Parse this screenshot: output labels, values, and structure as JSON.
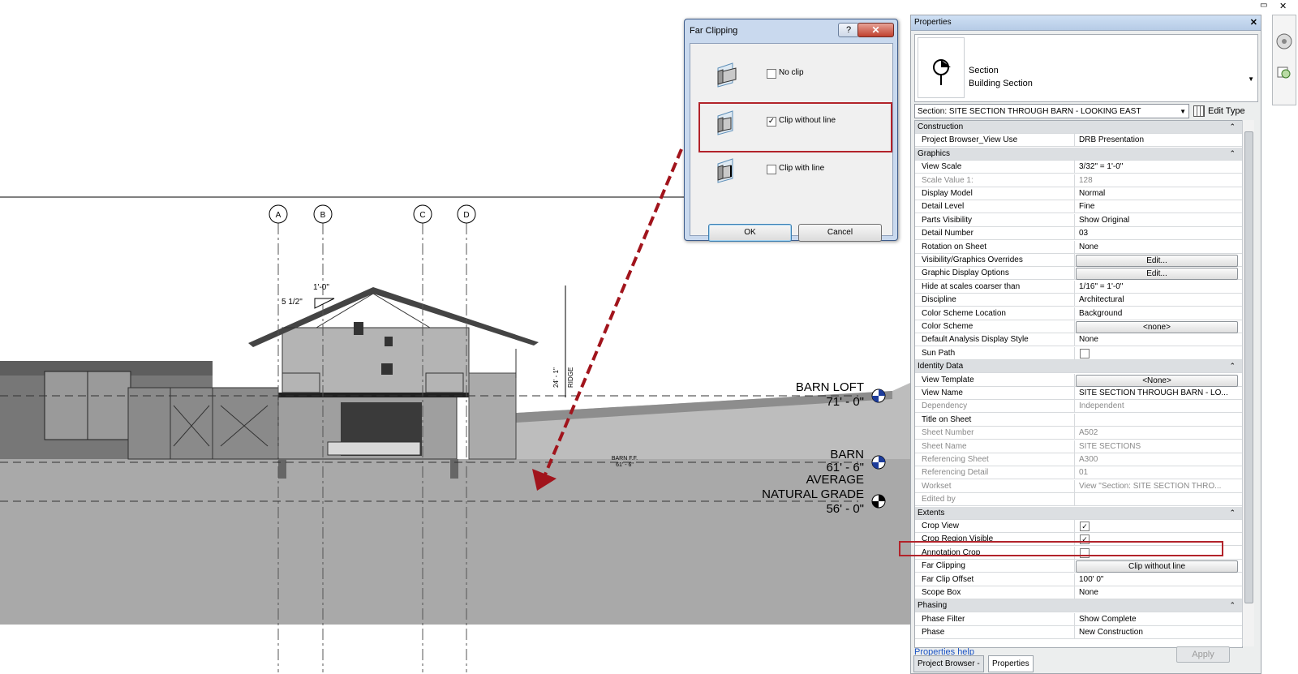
{
  "drawing": {
    "grids": [
      "A",
      "B",
      "C",
      "D"
    ],
    "dim_rise": "1'-0\"",
    "dim_pitch": "5 1/2\"",
    "dim_height": "24' - 1\"",
    "dim_label": "RIDGE",
    "level_barn_loft": "BARN LOFT",
    "level_barn_loft_elev": "71' - 0\"",
    "level_barn": "BARN",
    "level_barn_elev": "61' - 6\"",
    "level_grade_1": "AVERAGE",
    "level_grade_2": "NATURAL GRADE",
    "level_grade_elev": "56' - 0\"",
    "floor_label": "BARN F.F.",
    "floor_elev": "61' - 6\""
  },
  "dialog": {
    "title": "Far Clipping",
    "help": "?",
    "close": "✕",
    "options": [
      {
        "label": "No clip",
        "checked": false
      },
      {
        "label": "Clip without line",
        "checked": true
      },
      {
        "label": "Clip with line",
        "checked": false
      }
    ],
    "ok": "OK",
    "cancel": "Cancel"
  },
  "properties": {
    "title": "Properties",
    "close": "✕",
    "type_name": "Section",
    "type_subname": "Building Section",
    "instance_selector": "Section: SITE SECTION THROUGH BARN - LOOKING EAST",
    "edit_type": "Edit Type",
    "rows": [
      {
        "kind": "group",
        "k": "Construction"
      },
      {
        "k": "Project Browser_View Use",
        "v": "DRB Presentation"
      },
      {
        "kind": "group",
        "k": "Graphics"
      },
      {
        "k": "View Scale",
        "v": "3/32\" = 1'-0\""
      },
      {
        "k": "Scale Value    1:",
        "v": "128",
        "dis": true
      },
      {
        "k": "Display Model",
        "v": "Normal"
      },
      {
        "k": "Detail Level",
        "v": "Fine"
      },
      {
        "k": "Parts Visibility",
        "v": "Show Original"
      },
      {
        "k": "Detail Number",
        "v": "03"
      },
      {
        "k": "Rotation on Sheet",
        "v": "None"
      },
      {
        "k": "Visibility/Graphics Overrides",
        "btn": "Edit..."
      },
      {
        "k": "Graphic Display Options",
        "btn": "Edit..."
      },
      {
        "k": "Hide at scales coarser than",
        "v": "1/16\" = 1'-0\""
      },
      {
        "k": "Discipline",
        "v": "Architectural"
      },
      {
        "k": "Color Scheme Location",
        "v": "Background"
      },
      {
        "k": "Color Scheme",
        "btn": "<none>"
      },
      {
        "k": "Default Analysis Display Style",
        "v": "None"
      },
      {
        "k": "Sun Path",
        "chk": false
      },
      {
        "kind": "group",
        "k": "Identity Data"
      },
      {
        "k": "View Template",
        "btn": "<None>"
      },
      {
        "k": "View Name",
        "v": "SITE SECTION THROUGH BARN - LO..."
      },
      {
        "k": "Dependency",
        "v": "Independent",
        "dis": true
      },
      {
        "k": "Title on Sheet",
        "v": ""
      },
      {
        "k": "Sheet Number",
        "v": "A502",
        "dis": true
      },
      {
        "k": "Sheet Name",
        "v": "SITE SECTIONS",
        "dis": true
      },
      {
        "k": "Referencing Sheet",
        "v": "A300",
        "dis": true
      },
      {
        "k": "Referencing Detail",
        "v": "01",
        "dis": true
      },
      {
        "k": "Workset",
        "v": "View \"Section: SITE SECTION THRO...",
        "dis": true
      },
      {
        "k": "Edited by",
        "v": "",
        "dis": true
      },
      {
        "kind": "group",
        "k": "Extents"
      },
      {
        "k": "Crop View",
        "chk": true
      },
      {
        "k": "Crop Region Visible",
        "chk": true
      },
      {
        "k": "Annotation Crop",
        "chk": false
      },
      {
        "k": "Far Clipping",
        "btn": "Clip without line"
      },
      {
        "k": "Far Clip Offset",
        "v": "100'  0\""
      },
      {
        "k": "Scope Box",
        "v": "None"
      },
      {
        "kind": "group",
        "k": "Phasing"
      },
      {
        "k": "Phase Filter",
        "v": "Show Complete"
      },
      {
        "k": "Phase",
        "v": "New Construction"
      }
    ],
    "help_link": "Properties help",
    "apply": "Apply",
    "tabs": [
      "Project Browser -",
      "Properties"
    ]
  }
}
